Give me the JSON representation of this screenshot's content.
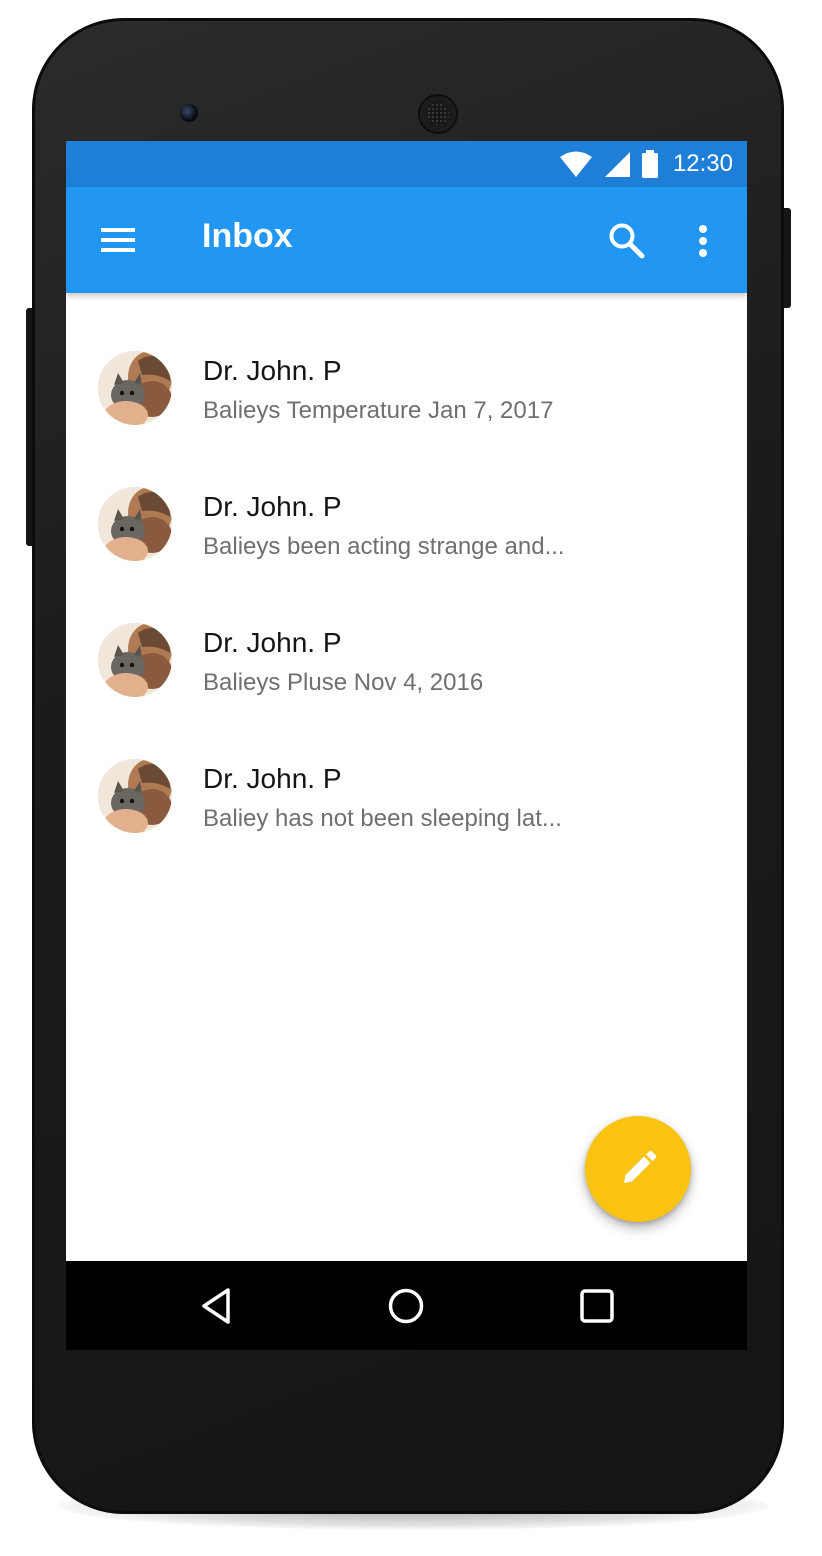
{
  "device": {
    "status_bar": {
      "time": "12:30",
      "icons": [
        "wifi-icon",
        "cellular-signal-icon",
        "battery-icon"
      ]
    }
  },
  "app_bar": {
    "title": "Inbox",
    "left_icon": "menu-icon",
    "right_icons": [
      "search-icon",
      "more-vert-icon"
    ],
    "color": "#2196F3",
    "status_color": "#1E7FD8"
  },
  "inbox": {
    "items": [
      {
        "sender": "Dr. John. P",
        "preview": "Balieys Temperature Jan 7, 2017"
      },
      {
        "sender": "Dr. John. P",
        "preview": "Balieys been acting strange and..."
      },
      {
        "sender": "Dr. John. P",
        "preview": "Balieys Pluse Nov 4, 2016"
      },
      {
        "sender": "Dr. John. P",
        "preview": "Baliey has not been sleeping lat..."
      }
    ]
  },
  "fab": {
    "icon": "edit-pencil-icon",
    "color": "#FBC311"
  },
  "system_nav": {
    "buttons": [
      "back-icon",
      "home-icon",
      "recents-icon"
    ]
  }
}
